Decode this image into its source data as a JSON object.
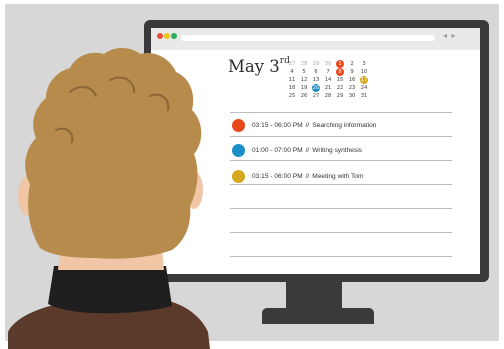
{
  "screen": {
    "calendar": {
      "date_label": "May 3",
      "date_suffix": "rd",
      "weeks": [
        [
          {
            "d": "27",
            "muted": true
          },
          {
            "d": "28",
            "muted": true
          },
          {
            "d": "29",
            "muted": true
          },
          {
            "d": "30",
            "muted": true
          },
          {
            "d": "1",
            "hl": "#e8471a"
          },
          {
            "d": "2"
          },
          {
            "d": "3"
          }
        ],
        [
          {
            "d": "4"
          },
          {
            "d": "5"
          },
          {
            "d": "6"
          },
          {
            "d": "7"
          },
          {
            "d": "8",
            "hl": "#e8471a"
          },
          {
            "d": "9"
          },
          {
            "d": "10"
          }
        ],
        [
          {
            "d": "11"
          },
          {
            "d": "12"
          },
          {
            "d": "13"
          },
          {
            "d": "14"
          },
          {
            "d": "15"
          },
          {
            "d": "16"
          },
          {
            "d": "17",
            "hl": "#d6a81e"
          }
        ],
        [
          {
            "d": "18"
          },
          {
            "d": "19"
          },
          {
            "d": "20",
            "hl": "#1b8fc7"
          },
          {
            "d": "21"
          },
          {
            "d": "22"
          },
          {
            "d": "23"
          },
          {
            "d": "24"
          }
        ],
        [
          {
            "d": "25"
          },
          {
            "d": "26"
          },
          {
            "d": "27"
          },
          {
            "d": "28"
          },
          {
            "d": "29"
          },
          {
            "d": "30"
          },
          {
            "d": "31"
          }
        ]
      ]
    },
    "events": [
      {
        "time": "03:15 - 06:00 PM",
        "sep": "//",
        "title": "Searching information",
        "color": "#e8471a"
      },
      {
        "time": "01:00 - 07:00 PM",
        "sep": "//",
        "title": "Writing synthesis",
        "color": "#1b8fc7"
      },
      {
        "time": "03:15 - 06:00 PM",
        "sep": "//",
        "title": "Meeting with Tom",
        "color": "#d6a81e"
      }
    ],
    "nav": {
      "arrows": "◂ ▸"
    }
  },
  "colors": {
    "background": "#d7d7d7",
    "monitor": "#3a3a3c",
    "hair": "#b78b4c",
    "skin": "#f0c6a6",
    "sweater": "#1e1e1e",
    "jacket": "#5b3a2c"
  }
}
